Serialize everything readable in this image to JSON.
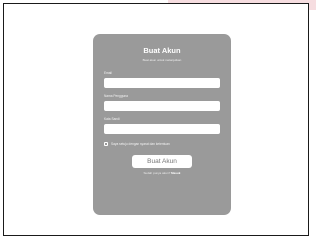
{
  "form": {
    "title": "Buat Akun",
    "subtitle": "Buat akun untuk melanjutkan",
    "fields": [
      {
        "label": "Email",
        "value": "",
        "placeholder": ""
      },
      {
        "label": "Nama Pengguna",
        "value": "",
        "placeholder": ""
      },
      {
        "label": "Kata Sandi",
        "value": "",
        "placeholder": ""
      }
    ],
    "consent_label": "Saya setuju dengan syarat dan ketentuan",
    "consent_checked": false,
    "submit_label": "Buat Akun",
    "login_prompt": "Sudah punya akun?",
    "login_link": "Masuk"
  },
  "colors": {
    "card": "#9a9a9a",
    "accent_strip": "#f6dde0",
    "frame_border": "#1a1a1a"
  }
}
